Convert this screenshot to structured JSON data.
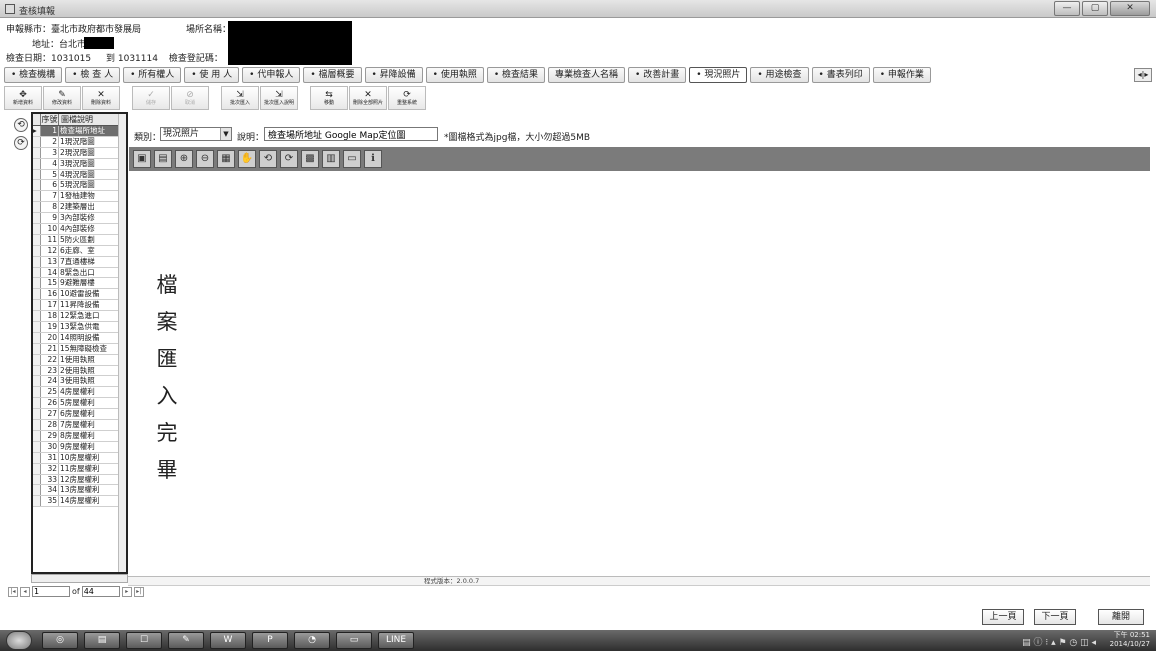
{
  "window": {
    "title": "查核填報",
    "controls": [
      "—",
      "▢",
      "✕"
    ]
  },
  "info": {
    "county_label": "申報縣市：",
    "county_value": "臺北市政府都市發展局",
    "venue_label": "場所名稱：",
    "address_label": "地址：",
    "address_value": "台北市",
    "date_label": "檢查日期：",
    "date_value": "1031015",
    "to_label": "到",
    "to_value": "1031114",
    "reg_label": "檢查登記碼："
  },
  "tabs": [
    {
      "label": "• 檢查機構",
      "active": false
    },
    {
      "label": "• 檢 查 人",
      "active": false
    },
    {
      "label": "• 所有權人",
      "active": false
    },
    {
      "label": "• 使 用 人",
      "active": false
    },
    {
      "label": "• 代申報人",
      "active": false
    },
    {
      "label": "• 檔層概要",
      "active": false
    },
    {
      "label": "• 昇降設備",
      "active": false
    },
    {
      "label": "• 使用執照",
      "active": false
    },
    {
      "label": "• 檢查結果",
      "active": false
    },
    {
      "label": "專業檢查人名稱",
      "active": false
    },
    {
      "label": "• 改善計畫",
      "active": false
    },
    {
      "label": "• 現況照片",
      "active": true
    },
    {
      "label": "• 用途檢查",
      "active": false
    },
    {
      "label": "• 書表列印",
      "active": false
    },
    {
      "label": "• 申報作業",
      "active": false
    }
  ],
  "tab_scroll": "◂|▸",
  "toolbar": [
    {
      "glyph": "✥",
      "label": "新增資料",
      "disabled": false
    },
    {
      "glyph": "✎",
      "label": "修改資料",
      "disabled": false
    },
    {
      "glyph": "✕",
      "label": "刪除資料",
      "disabled": false
    },
    {
      "glyph": "✓",
      "label": "儲存",
      "disabled": true
    },
    {
      "glyph": "⊘",
      "label": "取消",
      "disabled": true
    },
    {
      "glyph": "⇲",
      "label": "批次匯入",
      "disabled": false
    },
    {
      "glyph": "⇲",
      "label": "批次匯入說明",
      "disabled": false
    },
    {
      "glyph": "⇆",
      "label": "移動",
      "disabled": false
    },
    {
      "glyph": "✕",
      "label": "刪除全部照片",
      "disabled": false
    },
    {
      "glyph": "⟳",
      "label": "重整系統",
      "disabled": false
    }
  ],
  "side_buttons": [
    "⟲",
    "⟳"
  ],
  "grid": {
    "headers": [
      "序號",
      "圖檔說明"
    ],
    "rows": [
      [
        "1",
        "檢查場所地址"
      ],
      [
        "2",
        "1現況階圖"
      ],
      [
        "3",
        "2現況階圖"
      ],
      [
        "4",
        "3現況階圖"
      ],
      [
        "5",
        "4現況階圖"
      ],
      [
        "6",
        "5現況階圖"
      ],
      [
        "7",
        "1發柚建物"
      ],
      [
        "8",
        "2建築層出"
      ],
      [
        "9",
        "3內部裝修"
      ],
      [
        "10",
        "4內部裝修"
      ],
      [
        "11",
        "5防火區劃"
      ],
      [
        "12",
        "6走廊、室"
      ],
      [
        "13",
        "7直通樓梯"
      ],
      [
        "14",
        "8緊急出口"
      ],
      [
        "15",
        "9避難層樓"
      ],
      [
        "16",
        "10避雷設備"
      ],
      [
        "17",
        "11昇降設備"
      ],
      [
        "18",
        "12緊急進口"
      ],
      [
        "19",
        "13緊急供電"
      ],
      [
        "20",
        "14照明設備"
      ],
      [
        "21",
        "15無障礙檢查"
      ],
      [
        "22",
        "1使用執照"
      ],
      [
        "23",
        "2使用執照"
      ],
      [
        "24",
        "3使用執照"
      ],
      [
        "25",
        "4房屋權利"
      ],
      [
        "26",
        "5房屋權利"
      ],
      [
        "27",
        "6房屋權利"
      ],
      [
        "28",
        "7房屋權利"
      ],
      [
        "29",
        "8房屋權利"
      ],
      [
        "30",
        "9房屋權利"
      ],
      [
        "31",
        "10房屋權利"
      ],
      [
        "32",
        "11房屋權利"
      ],
      [
        "33",
        "12房屋權利"
      ],
      [
        "34",
        "13房屋權利"
      ],
      [
        "35",
        "14房屋權利"
      ]
    ],
    "selected_index": 0
  },
  "navigator": {
    "first": "|◂",
    "prev": "◂",
    "current": "1",
    "of_label": "of",
    "total": "44",
    "next": "▸",
    "last": "▸|"
  },
  "form": {
    "category_label": "類別：",
    "category_value": "現況照片",
    "description_label": "說明：",
    "description_value": "檢查場所地址 Google Map定位圖",
    "hint": "*圖檔格式為jpg檔，大小勿超過5MB"
  },
  "viewer_tools": [
    "▣",
    "▤",
    "⊕",
    "⊖",
    "▦",
    "✋",
    "⟲",
    "⟳",
    "▩",
    "▥",
    "▭",
    "ℹ"
  ],
  "done_message": [
    "檔",
    "案",
    "匯",
    "入",
    "完",
    "畢"
  ],
  "status": {
    "version": "程式版本：2.0.0.7"
  },
  "bottom_buttons": {
    "prev_page": "上一頁",
    "next_page": "下一頁",
    "exit": "離開"
  },
  "taskbar": {
    "apps": [
      "◎",
      "▤",
      "☐",
      "✎",
      "W",
      "P",
      "◔",
      "▭",
      "LINE"
    ],
    "tray": "▤ ⓘ ⁝ ▴ ⚑ ◷ ◫ ◂",
    "time": "下午 02:51",
    "date": "2014/10/27"
  }
}
